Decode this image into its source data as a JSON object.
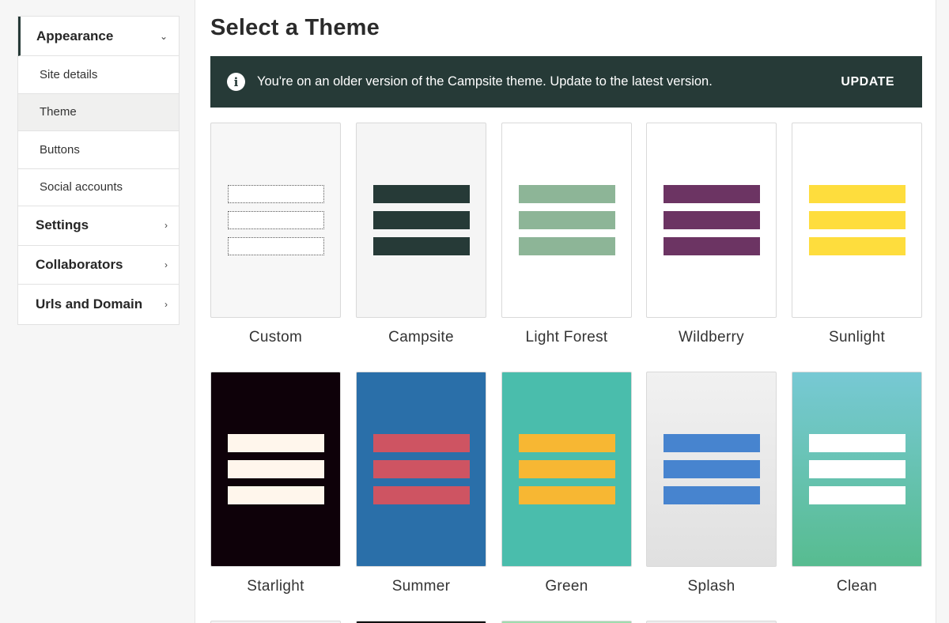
{
  "sidebar": {
    "appearance": "Appearance",
    "sub_items": [
      "Site details",
      "Theme",
      "Buttons",
      "Social accounts"
    ],
    "active_sub": "Theme",
    "items": [
      "Settings",
      "Collaborators",
      "Urls and Domain"
    ]
  },
  "main": {
    "title": "Select a Theme",
    "notice": {
      "text": "You're on an older version of the Campsite theme. Update to the latest version.",
      "button": "UPDATE"
    },
    "themes": [
      {
        "name": "Custom",
        "bg": "#f7f7f7",
        "bar": "dotted"
      },
      {
        "name": "Campsite",
        "bg": "#f5f5f5",
        "bar": "#263a37"
      },
      {
        "name": "Light Forest",
        "bg": "#ffffff",
        "bar": "#8db597"
      },
      {
        "name": "Wildberry",
        "bg": "#ffffff",
        "bar": "#6c3463"
      },
      {
        "name": "Sunlight",
        "bg": "#ffffff",
        "bar": "#fedd3d"
      },
      {
        "name": "Starlight",
        "bg": "#0e0109",
        "bar": "#fff6ec"
      },
      {
        "name": "Summer",
        "bg": "#2a6fa9",
        "bar": "#ce5462"
      },
      {
        "name": "Green",
        "bg": "#4abdac",
        "bar": "#f7b733"
      },
      {
        "name": "Splash",
        "bg": "linear-gradient(#f1f1f1,#e0e0e0)",
        "bar": "#4784cf"
      },
      {
        "name": "Clean",
        "bg": "linear-gradient(#77c9d4,#57bc90)",
        "bar": "#ffffff"
      }
    ]
  }
}
